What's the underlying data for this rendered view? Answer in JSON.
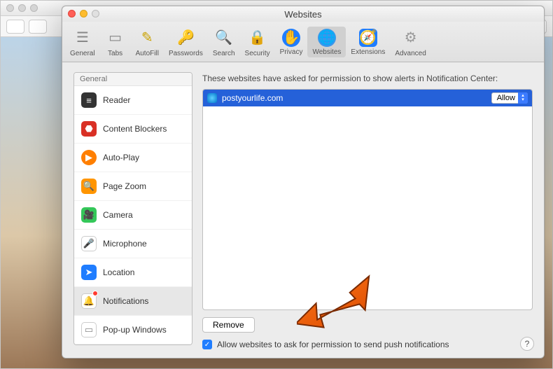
{
  "window": {
    "title": "Websites"
  },
  "toolbar": [
    {
      "label": "General",
      "key": "general"
    },
    {
      "label": "Tabs",
      "key": "tabs"
    },
    {
      "label": "AutoFill",
      "key": "autofill"
    },
    {
      "label": "Passwords",
      "key": "passwords"
    },
    {
      "label": "Search",
      "key": "search"
    },
    {
      "label": "Security",
      "key": "security"
    },
    {
      "label": "Privacy",
      "key": "privacy"
    },
    {
      "label": "Websites",
      "key": "websites",
      "selected": true
    },
    {
      "label": "Extensions",
      "key": "extensions"
    },
    {
      "label": "Advanced",
      "key": "advanced"
    }
  ],
  "sidebar": {
    "header": "General",
    "items": [
      {
        "label": "Reader",
        "key": "reader"
      },
      {
        "label": "Content Blockers",
        "key": "content-blockers"
      },
      {
        "label": "Auto-Play",
        "key": "auto-play"
      },
      {
        "label": "Page Zoom",
        "key": "page-zoom"
      },
      {
        "label": "Camera",
        "key": "camera"
      },
      {
        "label": "Microphone",
        "key": "microphone"
      },
      {
        "label": "Location",
        "key": "location"
      },
      {
        "label": "Notifications",
        "key": "notifications",
        "selected": true,
        "badge": true
      },
      {
        "label": "Pop-up Windows",
        "key": "popup"
      }
    ]
  },
  "main": {
    "description": "These websites have asked for permission to show alerts in Notification Center:",
    "rows": [
      {
        "site": "postyourlife.com",
        "setting": "Allow"
      }
    ],
    "remove_label": "Remove",
    "checkbox_label": "Allow websites to ask for permission to send push notifications",
    "checkbox_checked": true
  },
  "help": "?"
}
